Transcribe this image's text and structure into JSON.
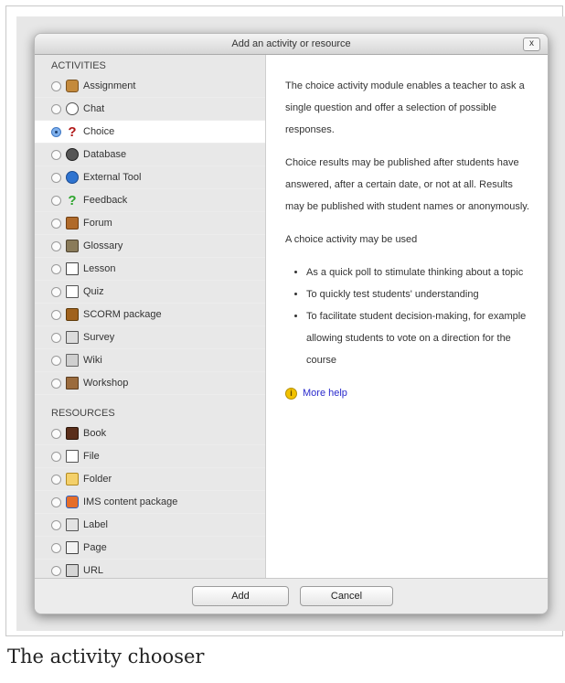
{
  "dialog": {
    "title": "Add an activity or resource",
    "close_label": "x"
  },
  "activities": {
    "heading": "ACTIVITIES",
    "items": [
      {
        "label": "Assignment",
        "icon": "assignment-icon",
        "selected": false
      },
      {
        "label": "Chat",
        "icon": "chat-icon",
        "selected": false
      },
      {
        "label": "Choice",
        "icon": "question-mark-icon",
        "selected": true
      },
      {
        "label": "Database",
        "icon": "database-icon",
        "selected": false
      },
      {
        "label": "External Tool",
        "icon": "globe-icon",
        "selected": false
      },
      {
        "label": "Feedback",
        "icon": "feedback-icon",
        "selected": false
      },
      {
        "label": "Forum",
        "icon": "forum-icon",
        "selected": false
      },
      {
        "label": "Glossary",
        "icon": "glossary-icon",
        "selected": false
      },
      {
        "label": "Lesson",
        "icon": "lesson-icon",
        "selected": false
      },
      {
        "label": "Quiz",
        "icon": "quiz-icon",
        "selected": false
      },
      {
        "label": "SCORM package",
        "icon": "package-icon",
        "selected": false
      },
      {
        "label": "Survey",
        "icon": "survey-icon",
        "selected": false
      },
      {
        "label": "Wiki",
        "icon": "wiki-icon",
        "selected": false
      },
      {
        "label": "Workshop",
        "icon": "workshop-icon",
        "selected": false
      }
    ]
  },
  "resources": {
    "heading": "RESOURCES",
    "items": [
      {
        "label": "Book",
        "icon": "book-icon",
        "selected": false
      },
      {
        "label": "File",
        "icon": "file-icon",
        "selected": false
      },
      {
        "label": "Folder",
        "icon": "folder-icon",
        "selected": false
      },
      {
        "label": "IMS content package",
        "icon": "ims-package-icon",
        "selected": false
      },
      {
        "label": "Label",
        "icon": "label-icon",
        "selected": false
      },
      {
        "label": "Page",
        "icon": "page-icon",
        "selected": false
      },
      {
        "label": "URL",
        "icon": "url-icon",
        "selected": false
      }
    ]
  },
  "description": {
    "para1": "The choice activity module enables a teacher to ask a single question and offer a selection of possible responses.",
    "para2": "Choice results may be published after students have answered, after a certain date, or not at all. Results may be published with student names or anonymously.",
    "para3": "A choice activity may be used",
    "bullets": [
      "As a quick poll to stimulate thinking about a topic",
      "To quickly test students' understanding",
      "To facilitate student decision-making, for example allowing students to vote on a direction for the course"
    ],
    "help_label": "More help"
  },
  "buttons": {
    "add": "Add",
    "cancel": "Cancel"
  },
  "caption": "The activity chooser",
  "colors": {
    "link": "#2a2acc",
    "selected_radio": "#7fb0ec"
  }
}
